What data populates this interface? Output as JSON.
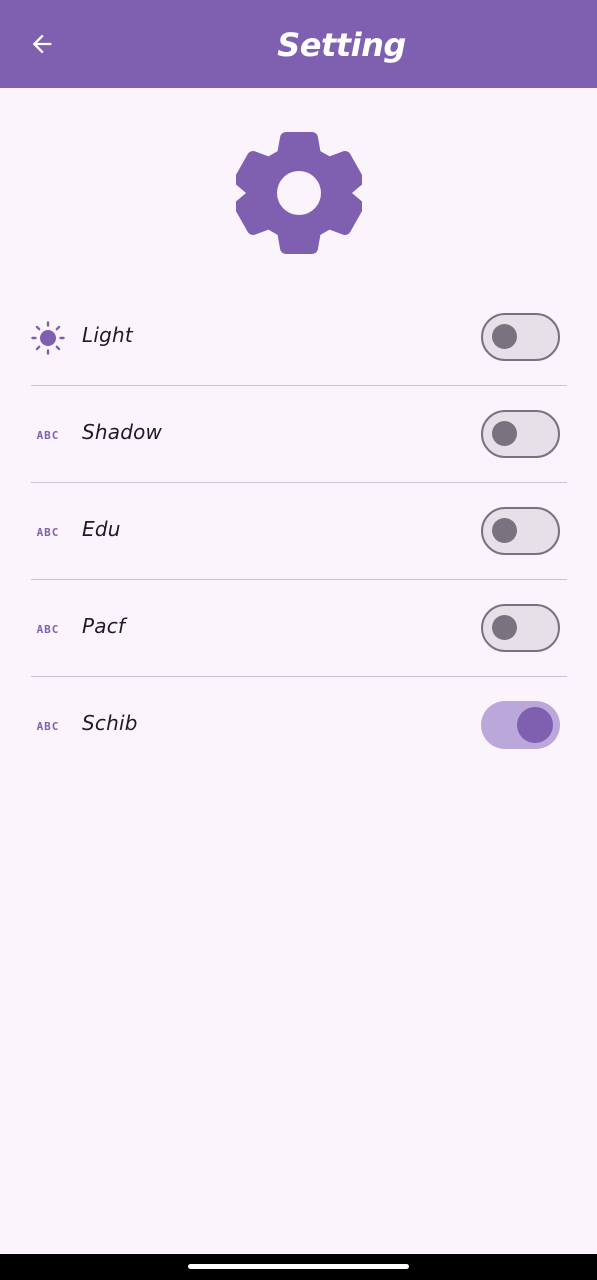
{
  "header": {
    "title": "Setting",
    "back_icon": "arrow-back-icon"
  },
  "hero": {
    "icon": "gear-icon"
  },
  "settings": [
    {
      "icon": "sun-icon",
      "label": "Light",
      "enabled": false
    },
    {
      "icon": "abc-icon",
      "icon_text": "ABC",
      "label": "Shadow",
      "enabled": false
    },
    {
      "icon": "abc-icon",
      "icon_text": "ABC",
      "label": "Edu",
      "enabled": false
    },
    {
      "icon": "abc-icon",
      "icon_text": "ABC",
      "label": "Pacf",
      "enabled": false
    },
    {
      "icon": "abc-icon",
      "icon_text": "ABC",
      "label": "Schib",
      "enabled": true
    }
  ],
  "colors": {
    "primary": "#7f5fb0",
    "background": "#fcf4fc",
    "toggle_on_track": "#bba7d9",
    "toggle_off_track": "#e6e0e9",
    "toggle_off_outline": "#78737e"
  }
}
